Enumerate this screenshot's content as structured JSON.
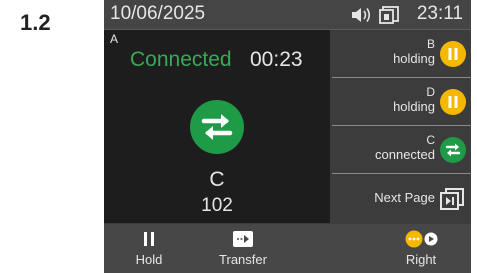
{
  "figure_label": "1.2",
  "status_bar": {
    "date": "10/06/2025",
    "time": "23:11",
    "icons": [
      "speaker-icon",
      "window-icon"
    ]
  },
  "active_call": {
    "line": "A",
    "status": "Connected",
    "timer": "00:23",
    "icon": "transfer-icon",
    "name": "C",
    "number": "102",
    "status_color": "#3aa857"
  },
  "side_calls": [
    {
      "line": "B",
      "state": "holding",
      "icon": "pause-icon",
      "color": "#f5b800"
    },
    {
      "line": "D",
      "state": "holding",
      "icon": "pause-icon",
      "color": "#f5b800"
    },
    {
      "line": "C",
      "state": "connected",
      "icon": "transfer-icon",
      "color": "#1f9a46"
    }
  ],
  "next_page": {
    "label": "Next Page",
    "icon": "next-page-icon"
  },
  "softkeys": [
    {
      "label": "Hold",
      "icon": "pause-icon"
    },
    {
      "label": "Transfer",
      "icon": "transfer-arrow-icon"
    },
    {
      "label": "Right",
      "icon": "more-icon"
    }
  ]
}
